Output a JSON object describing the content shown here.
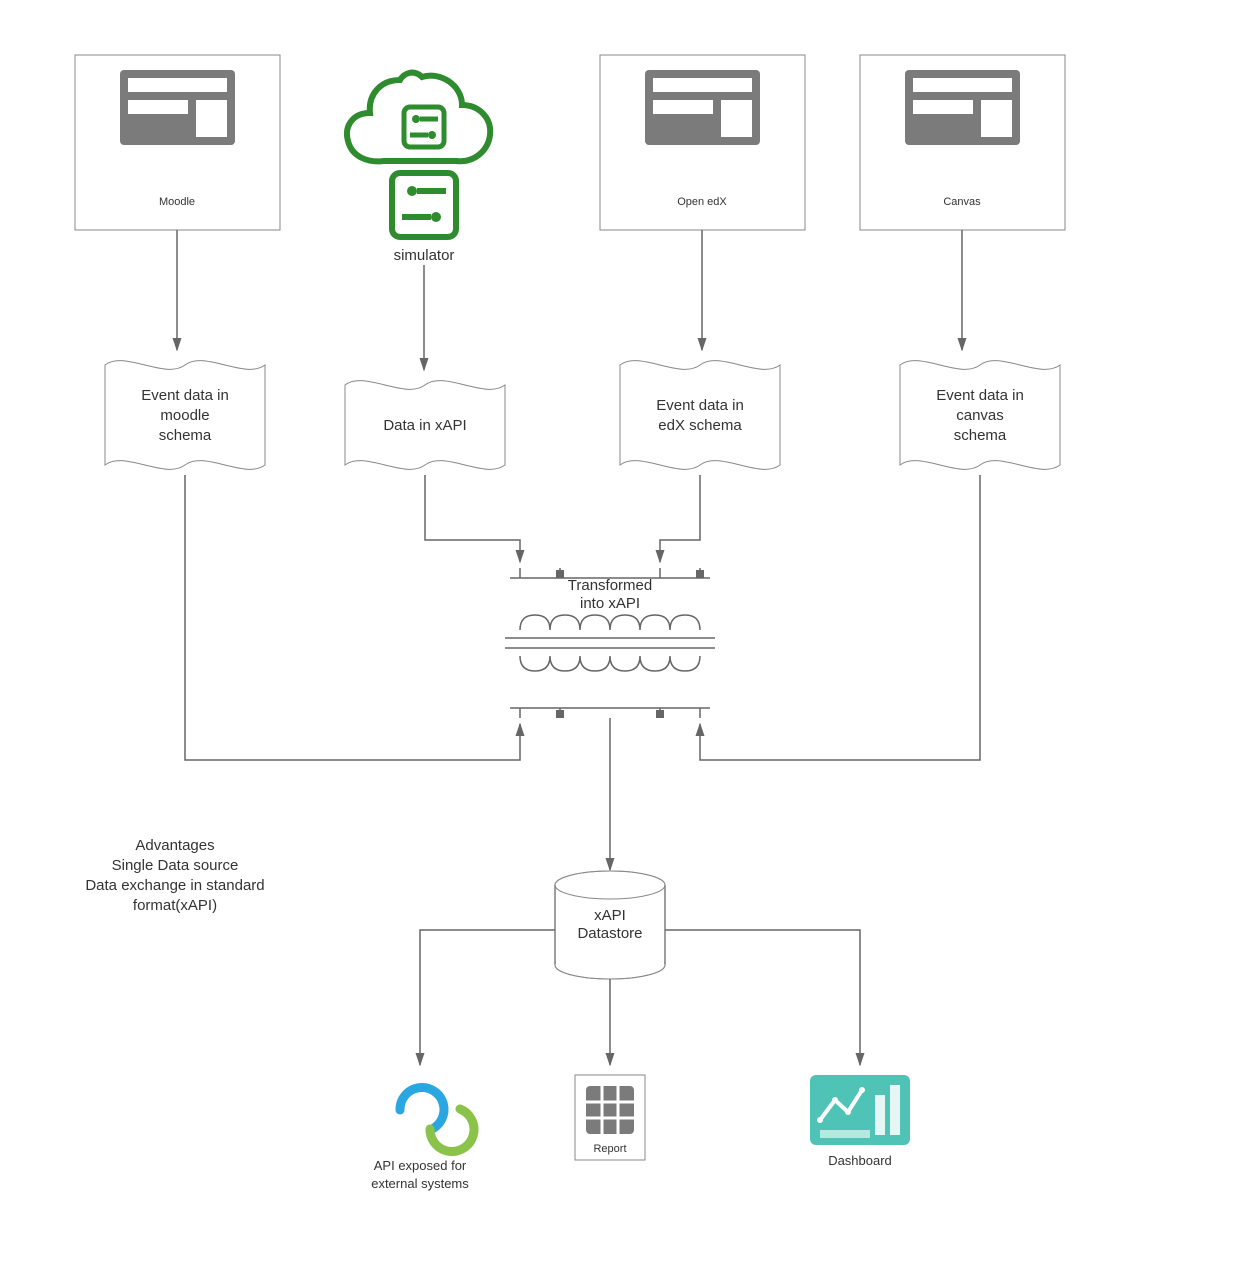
{
  "sources": {
    "moodle": {
      "label": "Moodle"
    },
    "simulator": {
      "label": "simulator"
    },
    "openedx": {
      "label": "Open edX"
    },
    "canvas": {
      "label": "Canvas"
    }
  },
  "events": {
    "moodle": {
      "line1": "Event data in",
      "line2": "moodle",
      "line3": "schema"
    },
    "xapi": {
      "line1": "Data in xAPI"
    },
    "edx": {
      "line1": "Event data in",
      "line2": "edX schema"
    },
    "canvas": {
      "line1": "Event data in",
      "line2": "canvas",
      "line3": "schema"
    }
  },
  "transformer": {
    "line1": "Transformed",
    "line2": "into xAPI"
  },
  "datastore": {
    "line1": "xAPI",
    "line2": "Datastore"
  },
  "outputs": {
    "api": {
      "line1": "API exposed for",
      "line2": "external systems"
    },
    "report": {
      "label": "Report"
    },
    "dashboard": {
      "label": "Dashboard"
    }
  },
  "advantages": {
    "title": "Advantages",
    "line2": "Single Data source",
    "line3": "Data exchange in standard",
    "line4": "format(xAPI)"
  }
}
